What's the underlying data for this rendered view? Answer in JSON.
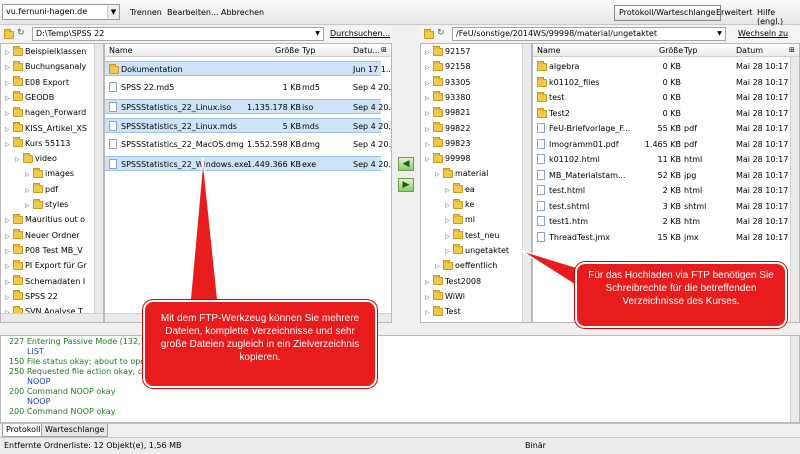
{
  "toolbar": {
    "server": "vu.fernuni-hagen.de",
    "trennen": "Trennen",
    "bearbeiten": "Bearbeiten...",
    "abbrechen": "Abbrechen",
    "protokoll_warteschlange": "Protokoll/Warteschlange",
    "erweitert": "Erweitert",
    "hilfe": "Hilfe (engl.)"
  },
  "left": {
    "path": "D:\\Temp\\SPSS 22",
    "durchsuchen": "Durchsuchen...",
    "tree": [
      {
        "label": "Beispielklassen",
        "indent": 0
      },
      {
        "label": "Buchungsanaly",
        "indent": 0
      },
      {
        "label": "E08 Export",
        "indent": 0
      },
      {
        "label": "GEODB",
        "indent": 0
      },
      {
        "label": "hagen_Forward",
        "indent": 0
      },
      {
        "label": "KISS_Artikel_XS",
        "indent": 0
      },
      {
        "label": "Kurs 55113",
        "indent": 0
      },
      {
        "label": "video",
        "indent": 1
      },
      {
        "label": "images",
        "indent": 2
      },
      {
        "label": "pdf",
        "indent": 2
      },
      {
        "label": "styles",
        "indent": 2
      },
      {
        "label": "Mauritius out o",
        "indent": 0
      },
      {
        "label": "Neuer Ordner",
        "indent": 0
      },
      {
        "label": "P08 Test MB_V",
        "indent": 0
      },
      {
        "label": "PI Export für Gr",
        "indent": 0
      },
      {
        "label": "Schemadaten I",
        "indent": 0
      },
      {
        "label": "SPSS 22",
        "indent": 0
      },
      {
        "label": "SVN Analyse T",
        "indent": 0
      }
    ],
    "columns": {
      "name": "Name",
      "size": "Größe",
      "type": "Typ",
      "date": "Datu..."
    },
    "files": [
      {
        "name": "Dokumentation",
        "size": "",
        "type": "",
        "date": "Jun 17 1...",
        "folder": true,
        "selected": true
      },
      {
        "name": "SPSS 22.md5",
        "size": "1 KB",
        "type": "md5",
        "date": "Sep 4 20...",
        "folder": false,
        "selected": false
      },
      {
        "name": "SPSSStatistics_22_Linux.iso",
        "size": "1.135.178 KB",
        "type": "iso",
        "date": "Sep 4 20...",
        "folder": false,
        "selected": true
      },
      {
        "name": "SPSSStatistics_22_Linux.mds",
        "size": "5 KB",
        "type": "mds",
        "date": "Sep 4 20...",
        "folder": false,
        "selected": true
      },
      {
        "name": "SPSSStatistics_22_MacOS.dmg",
        "size": "1.552.598 KB",
        "type": "dmg",
        "date": "Sep 4 20...",
        "folder": false,
        "selected": false
      },
      {
        "name": "SPSSStatistics_22_Windows.exe",
        "size": "1.449.366 KB",
        "type": "exe",
        "date": "Sep 4 20...",
        "folder": false,
        "selected": true
      }
    ]
  },
  "right": {
    "path": "/FeU/sonstige/2014WS/99998/material/ungetaktet",
    "wechseln": "Wechseln zu",
    "tree": [
      {
        "label": "92157",
        "indent": 0
      },
      {
        "label": "92158",
        "indent": 0
      },
      {
        "label": "93305",
        "indent": 0
      },
      {
        "label": "93380",
        "indent": 0
      },
      {
        "label": "99821",
        "indent": 0
      },
      {
        "label": "99822",
        "indent": 0
      },
      {
        "label": "99823",
        "indent": 0
      },
      {
        "label": "99998",
        "indent": 0
      },
      {
        "label": "material",
        "indent": 1
      },
      {
        "label": "ea",
        "indent": 2
      },
      {
        "label": "ke",
        "indent": 2
      },
      {
        "label": "ml",
        "indent": 2
      },
      {
        "label": "test_neu",
        "indent": 2
      },
      {
        "label": "ungetaktet",
        "indent": 2
      },
      {
        "label": "oeffentlich",
        "indent": 1
      },
      {
        "label": "Test2008",
        "indent": 0
      },
      {
        "label": "WiWi",
        "indent": 0
      },
      {
        "label": "Test",
        "indent": 0
      }
    ],
    "columns": {
      "name": "Name",
      "size": "Größe",
      "type": "Typ",
      "date": "Datum"
    },
    "files": [
      {
        "name": "algebra",
        "size": "0 KB",
        "type": "",
        "date": "Mai 28 10:17",
        "folder": true
      },
      {
        "name": "k01102_files",
        "size": "0 KB",
        "type": "",
        "date": "Mai 28 10:17",
        "folder": true
      },
      {
        "name": "test",
        "size": "0 KB",
        "type": "",
        "date": "Mai 28 10:17",
        "folder": true
      },
      {
        "name": "Test2",
        "size": "0 KB",
        "type": "",
        "date": "Mai 28 10:17",
        "folder": true
      },
      {
        "name": "FeU-Briefvorlage_F...",
        "size": "55 KB",
        "type": "pdf",
        "date": "Mai 28 10:17",
        "folder": false
      },
      {
        "name": "Imogramm01.pdf",
        "size": "1.465 KB",
        "type": "pdf",
        "date": "Mai 28 10:17",
        "folder": false
      },
      {
        "name": "k01102.html",
        "size": "11 KB",
        "type": "html",
        "date": "Mai 28 10:17",
        "folder": false
      },
      {
        "name": "MB_Materialstam...",
        "size": "52 KB",
        "type": "jpg",
        "date": "Mai 28 10:17",
        "folder": false
      },
      {
        "name": "test.html",
        "size": "2 KB",
        "type": "html",
        "date": "Mai 28 10:17",
        "folder": false
      },
      {
        "name": "test.shtml",
        "size": "3 KB",
        "type": "shtml",
        "date": "Mai 28 10:17",
        "folder": false
      },
      {
        "name": "test1.htm",
        "size": "2 KB",
        "type": "htm",
        "date": "Mai 28 10:17",
        "folder": false
      },
      {
        "name": "ThreadTest.jmx",
        "size": "15 KB",
        "type": "jmx",
        "date": "Mai 28 10:17",
        "folder": false
      }
    ]
  },
  "log": [
    {
      "text": "227 Entering Passive Mode (132,1",
      "cls": "g",
      "indent": false
    },
    {
      "text": "LIST",
      "cls": "b",
      "indent": true
    },
    {
      "text": "150 File status okay; about to ope",
      "cls": "g",
      "indent": false
    },
    {
      "text": "250 Requested file action okay, c",
      "cls": "g",
      "indent": false
    },
    {
      "text": "NOOP",
      "cls": "b",
      "indent": true
    },
    {
      "text": "200 Command NOOP okay",
      "cls": "g",
      "indent": false
    },
    {
      "text": "NOOP",
      "cls": "b",
      "indent": true
    },
    {
      "text": "200 Command NOOP okay",
      "cls": "g",
      "indent": false
    }
  ],
  "tabs": [
    "Protokoll",
    "Warteschlange"
  ],
  "status": {
    "left": "Entfernte Ordnerliste: 12 Objekt(e), 1,56 MB",
    "mode": "Binär"
  },
  "callouts": {
    "left": "Mit dem FTP-Werkzeug können Sie mehrere Dateien, komplette Verzeichnisse und sehr große Dateien zugleich in ein Zielverzeichnis kopieren.",
    "right": "Für das Hochladen via FTP benötigen Sie Schreibrechte für die betreffenden Verzeichnisse des Kurses."
  },
  "colors": {
    "callout": "#e81c1c",
    "selection": "#cde3f7",
    "folder": "#f2c94c"
  }
}
